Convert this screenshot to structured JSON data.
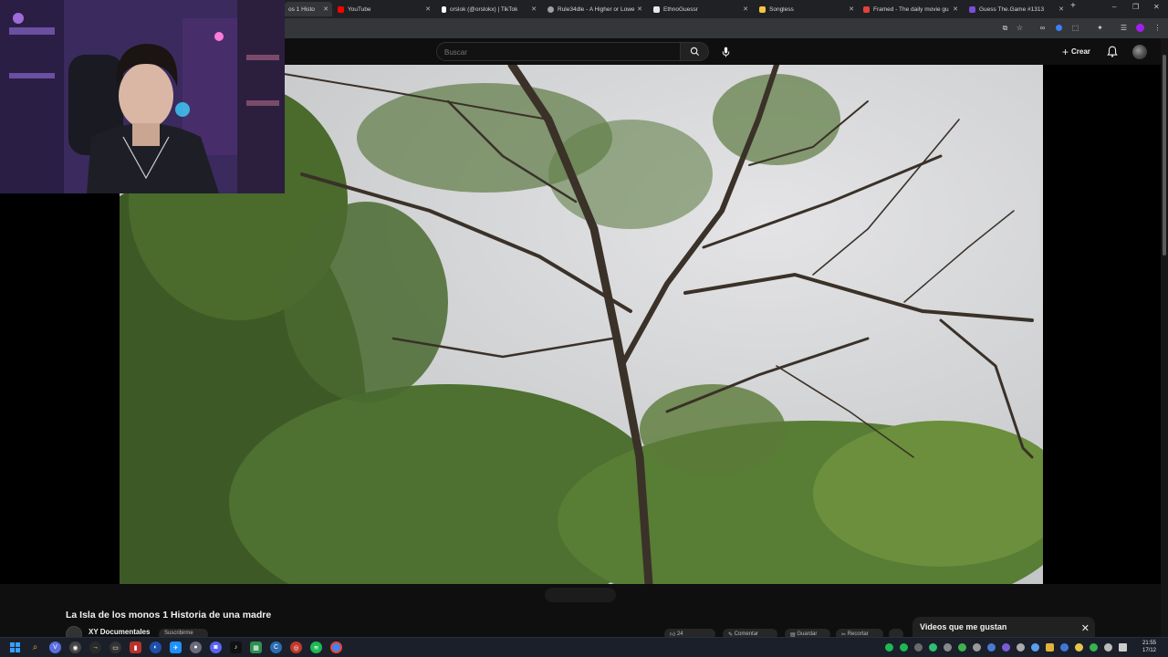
{
  "browser": {
    "tabs": [
      {
        "label": "os 1 Histo",
        "favicon": "youtube-icon",
        "color": "#ff0000",
        "active": true
      },
      {
        "label": "YouTube",
        "favicon": "youtube-icon",
        "color": "#ff0000"
      },
      {
        "label": "orslok (@orslokx) | TikTok",
        "favicon": "tiktok-icon",
        "color": "#ffffff"
      },
      {
        "label": "Rule34dle - A Higher or Lowe",
        "favicon": "globe-icon",
        "color": "#9aa0a6"
      },
      {
        "label": "EthnoGuessr",
        "favicon": "ethnoguessr-icon",
        "color": "#e8e8e8"
      },
      {
        "label": "Songless",
        "favicon": "songless-icon",
        "color": "#f4c542"
      },
      {
        "label": "Framed - The daily movie gu",
        "favicon": "framed-icon",
        "color": "#e0433b"
      },
      {
        "label": "Guess The.Game #1313",
        "favicon": "gtg-icon",
        "color": "#7b4dd8"
      }
    ],
    "new_tab_symbol": "+",
    "window_controls": {
      "minimize": "–",
      "maximize": "❐",
      "close": "✕"
    }
  },
  "youtube": {
    "search": {
      "placeholder": "Buscar",
      "value": ""
    },
    "create_label": "Crear",
    "video": {
      "title": "La Isla de los monos 1 Historia de una madre",
      "channel": "XY Documentales",
      "subscribe_label": "Suscribirme"
    },
    "actions": {
      "likes": "24",
      "comment_label": "Comentar",
      "save_label": "Guardar",
      "clip_label": "Recortar"
    },
    "playlist_panel": {
      "title": "Videos que me gustan",
      "close": "✕"
    }
  },
  "taskbar": {
    "time": "21:55",
    "date": "17/12"
  },
  "colors": {
    "chrome_bg": "#202124",
    "toolbar_bg": "#35363a",
    "yt_bg": "#0f0f0f",
    "accent_red": "#ff0000",
    "taskbar_bg": "#1b1f2a"
  }
}
